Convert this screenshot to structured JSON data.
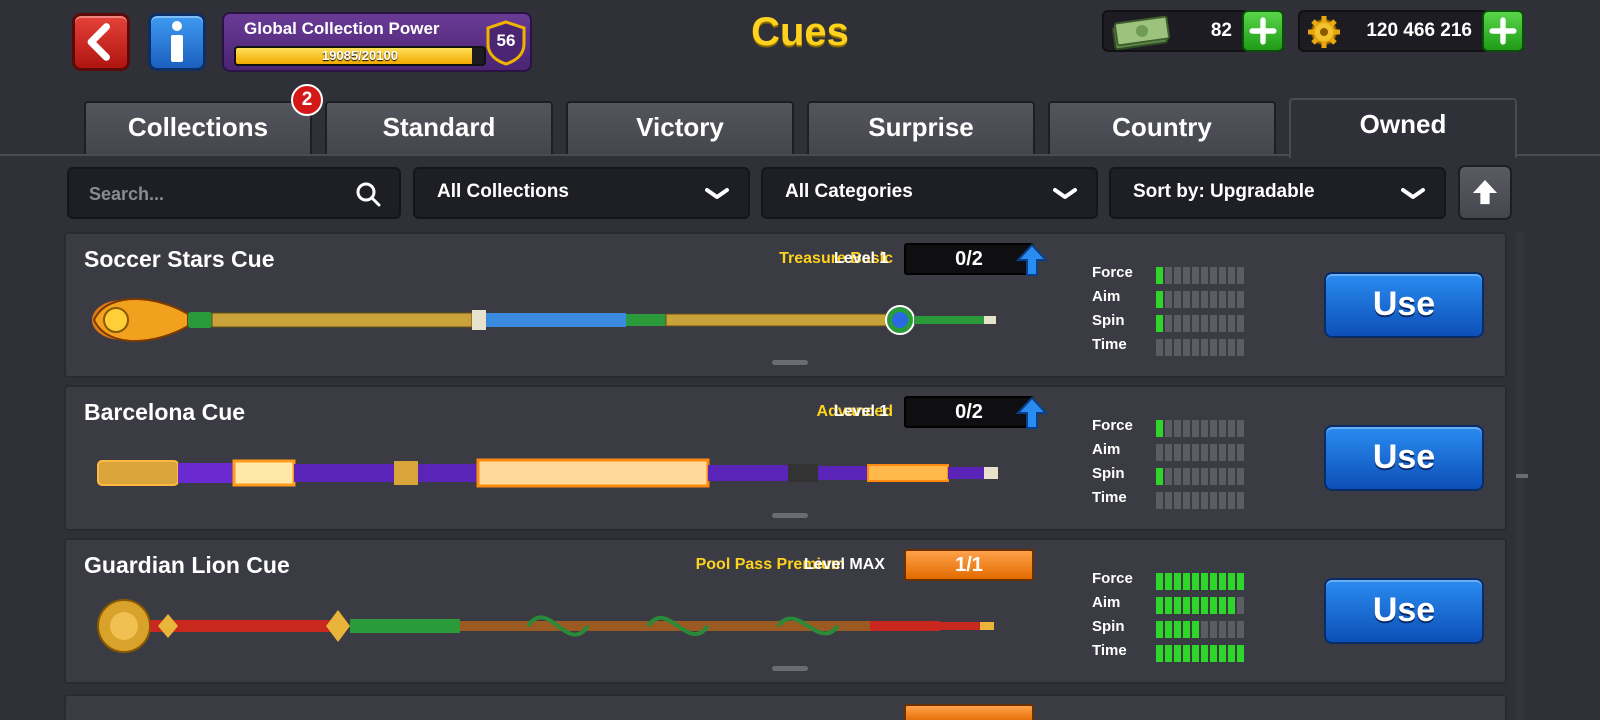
{
  "header": {
    "title": "Cues",
    "power": {
      "title": "Global Collection Power",
      "progress_text": "19085/20100",
      "progress_fraction": 0.95,
      "badge_level": "56"
    },
    "currency": {
      "cash": "82",
      "coins": "120 466 216"
    }
  },
  "tabs": [
    {
      "label": "Collections",
      "active": false
    },
    {
      "label": "Standard",
      "active": false
    },
    {
      "label": "Victory",
      "active": false
    },
    {
      "label": "Surprise",
      "active": false
    },
    {
      "label": "Country",
      "active": false
    },
    {
      "label": "Owned",
      "active": true
    }
  ],
  "notification_badge": "2",
  "filters": {
    "search_placeholder": "Search...",
    "collections": "All Collections",
    "categories": "All Categories",
    "sort": "Sort by: Upgradable"
  },
  "cues": [
    {
      "name": "Soccer Stars Cue",
      "tier": "Treasure Basic",
      "level": "Level 1",
      "progress": "0/2",
      "upgradable": true,
      "stats": {
        "Force": 1,
        "Aim": 1,
        "Spin": 1,
        "Time": 0
      },
      "use_label": "Use"
    },
    {
      "name": "Barcelona Cue",
      "tier": "Advanced",
      "level": "Level 1",
      "progress": "0/2",
      "upgradable": true,
      "stats": {
        "Force": 1,
        "Aim": 0,
        "Spin": 1,
        "Time": 0
      },
      "use_label": "Use"
    },
    {
      "name": "Guardian Lion Cue",
      "tier": "Pool Pass Premium",
      "level": "Level MAX",
      "progress": "1/1",
      "upgradable": false,
      "stats": {
        "Force": 10,
        "Aim": 9,
        "Spin": 5,
        "Time": 10
      },
      "use_label": "Use"
    }
  ],
  "stat_labels": [
    "Force",
    "Aim",
    "Spin",
    "Time"
  ],
  "stat_max": 10,
  "colors": {
    "accent_yellow": "#ffd21e",
    "use_blue": "#1a6fd8",
    "stat_green": "#2ed62a",
    "max_orange": "#f08a1a"
  }
}
